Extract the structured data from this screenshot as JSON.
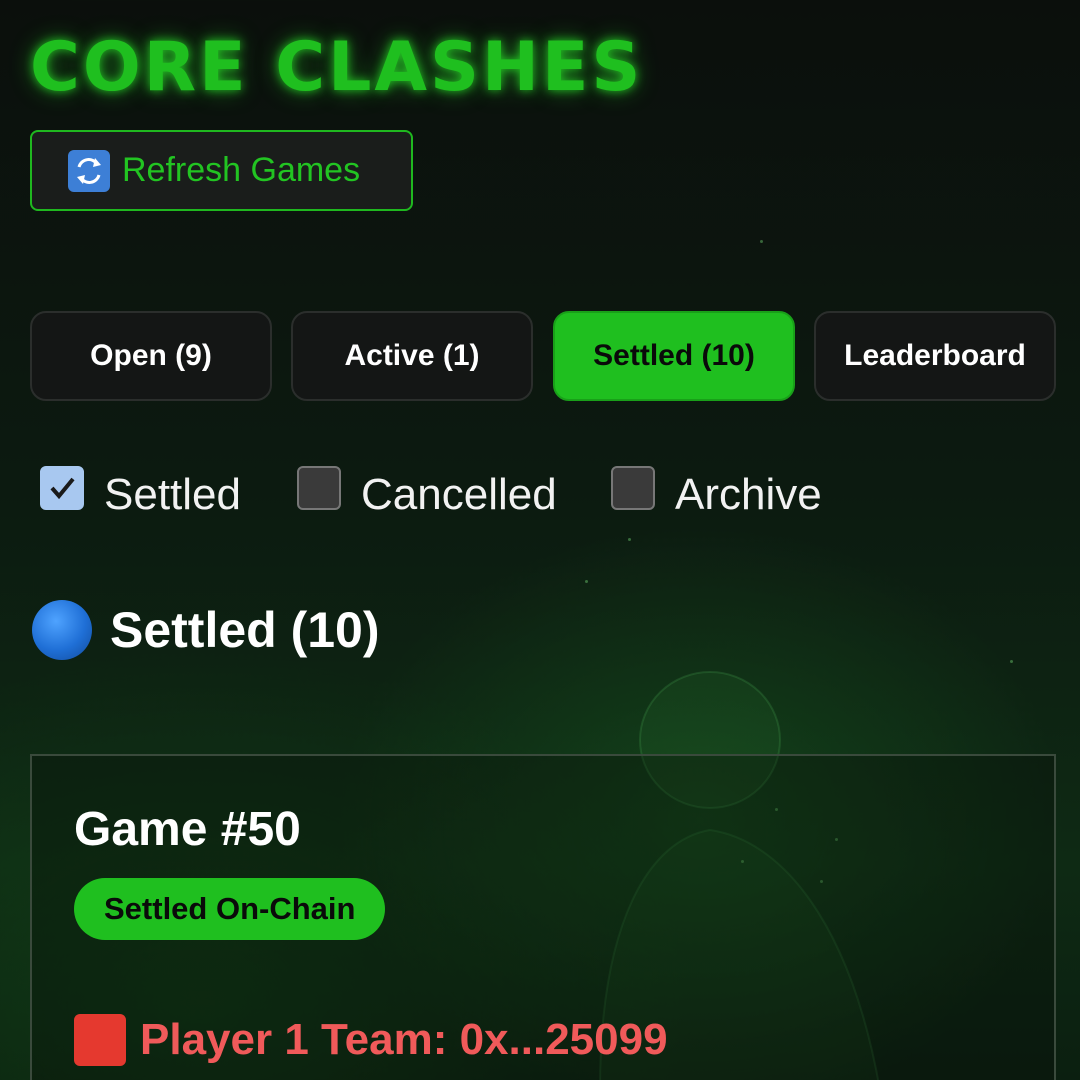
{
  "app": {
    "title": "CORE CLASHES"
  },
  "toolbar": {
    "refresh_label": "Refresh Games",
    "refresh_icon": "refresh-arrows-icon"
  },
  "tabs": [
    {
      "label": "Open (9)",
      "active": false
    },
    {
      "label": "Active (1)",
      "active": false
    },
    {
      "label": "Settled (10)",
      "active": true
    },
    {
      "label": "Leaderboard",
      "active": false
    }
  ],
  "filters": [
    {
      "label": "Settled",
      "checked": true
    },
    {
      "label": "Cancelled",
      "checked": false
    },
    {
      "label": "Archive",
      "checked": false
    }
  ],
  "section": {
    "title": "Settled (10)",
    "icon": "blue-circle-icon"
  },
  "game": {
    "title": "Game #50",
    "status": "Settled On-Chain",
    "player1_label": "Player 1 Team: 0x...25099",
    "player1_icon": "red-square-icon"
  },
  "colors": {
    "accent": "#1fbf1f",
    "player1": "#f05a5a",
    "checkbox_checked": "#a8c8f0"
  }
}
